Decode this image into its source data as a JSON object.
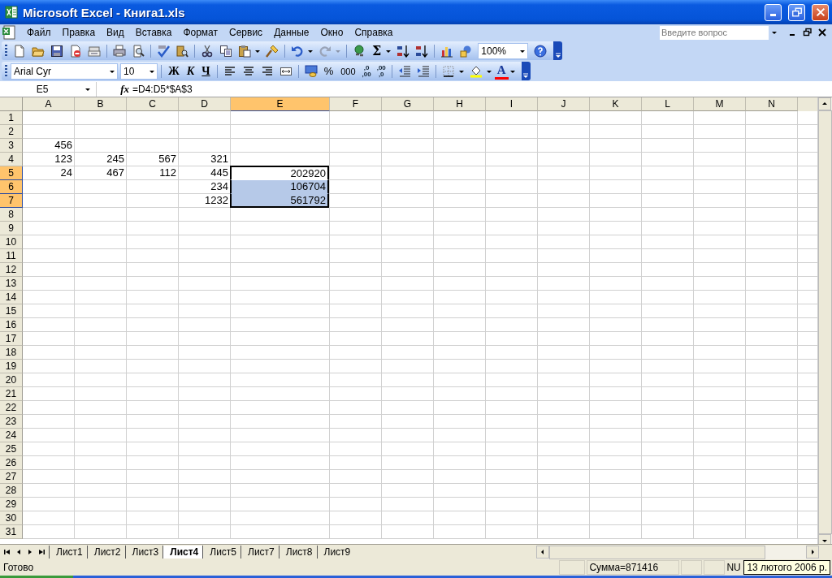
{
  "window": {
    "title": "Microsoft Excel - Книга1.xls"
  },
  "menu": [
    {
      "label": "Файл"
    },
    {
      "label": "Правка"
    },
    {
      "label": "Вид"
    },
    {
      "label": "Вставка"
    },
    {
      "label": "Формат"
    },
    {
      "label": "Сервис"
    },
    {
      "label": "Данные"
    },
    {
      "label": "Окно"
    },
    {
      "label": "Справка"
    }
  ],
  "help_search": {
    "placeholder": "Введите вопрос"
  },
  "standard_toolbar": {
    "autosum": "Σ",
    "zoom": "100%"
  },
  "formatting_toolbar": {
    "font": "Arial Cyr",
    "size": "10",
    "bold": "Ж",
    "italic": "К",
    "underline": "Ч",
    "percent": "%",
    "thousands": "000",
    "increase_decimal": [
      ",0",
      ",00"
    ],
    "decrease_decimal": [
      ",00",
      ",0"
    ],
    "font_color": "A"
  },
  "formula_bar": {
    "name_box": "E5",
    "fx": "fx",
    "formula": "=D4:D5*$A$3"
  },
  "columns": [
    {
      "label": "A",
      "selected": false
    },
    {
      "label": "B",
      "selected": false
    },
    {
      "label": "C",
      "selected": false
    },
    {
      "label": "D",
      "selected": false
    },
    {
      "label": "E",
      "selected": true
    },
    {
      "label": "F",
      "selected": false
    },
    {
      "label": "G",
      "selected": false
    },
    {
      "label": "H",
      "selected": false
    },
    {
      "label": "I",
      "selected": false
    },
    {
      "label": "J",
      "selected": false
    },
    {
      "label": "K",
      "selected": false
    },
    {
      "label": "L",
      "selected": false
    },
    {
      "label": "M",
      "selected": false
    },
    {
      "label": "N",
      "selected": false
    }
  ],
  "rows": [
    {
      "label": "1",
      "selected": false
    },
    {
      "label": "2",
      "selected": false
    },
    {
      "label": "3",
      "selected": false,
      "cells": [
        {
          "value": "456",
          "selected": false
        }
      ]
    },
    {
      "label": "4",
      "selected": false,
      "cells": [
        {
          "value": "123",
          "selected": false
        },
        {
          "value": "245",
          "selected": false
        },
        {
          "value": "567",
          "selected": false
        },
        {
          "value": "321",
          "selected": false
        }
      ]
    },
    {
      "label": "5",
      "selected": true,
      "cells": [
        {
          "value": "24",
          "selected": false
        },
        {
          "value": "467",
          "selected": false
        },
        {
          "value": "112",
          "selected": false
        },
        {
          "value": "445",
          "selected": false
        },
        {
          "value": "202920",
          "selected": true,
          "active": true
        }
      ]
    },
    {
      "label": "6",
      "selected": true,
      "cells": [
        null,
        null,
        null,
        {
          "value": "234",
          "selected": false
        },
        {
          "value": "106704",
          "selected": true,
          "active": false
        }
      ]
    },
    {
      "label": "7",
      "selected": true,
      "cells": [
        null,
        null,
        null,
        {
          "value": "1232",
          "selected": false
        },
        {
          "value": "561792",
          "selected": true,
          "active": false
        }
      ]
    },
    {
      "label": "8",
      "selected": false
    },
    {
      "label": "9",
      "selected": false
    },
    {
      "label": "10",
      "selected": false
    },
    {
      "label": "11",
      "selected": false
    },
    {
      "label": "12",
      "selected": false
    },
    {
      "label": "13",
      "selected": false
    },
    {
      "label": "14",
      "selected": false
    },
    {
      "label": "15",
      "selected": false
    },
    {
      "label": "16",
      "selected": false
    },
    {
      "label": "17",
      "selected": false
    },
    {
      "label": "18",
      "selected": false
    },
    {
      "label": "19",
      "selected": false
    },
    {
      "label": "20",
      "selected": false
    },
    {
      "label": "21",
      "selected": false
    },
    {
      "label": "22",
      "selected": false
    },
    {
      "label": "23",
      "selected": false
    },
    {
      "label": "24",
      "selected": false
    },
    {
      "label": "25",
      "selected": false
    },
    {
      "label": "26",
      "selected": false
    },
    {
      "label": "27",
      "selected": false
    },
    {
      "label": "28",
      "selected": false
    },
    {
      "label": "29",
      "selected": false
    },
    {
      "label": "30",
      "selected": false
    },
    {
      "label": "31",
      "selected": false
    }
  ],
  "sheet_tabs": [
    {
      "label": "Лист1",
      "selected": false
    },
    {
      "label": "Лист2",
      "selected": false
    },
    {
      "label": "Лист3",
      "selected": false
    },
    {
      "label": "Лист4",
      "selected": true
    },
    {
      "label": "Лист5",
      "selected": false
    },
    {
      "label": "Лист7",
      "selected": false
    },
    {
      "label": "Лист8",
      "selected": false
    },
    {
      "label": "Лист9",
      "selected": false
    }
  ],
  "status_bar": {
    "status": "Готово",
    "sum": "Сумма=871416",
    "num": "NU"
  },
  "tooltip": "13 лютого 2006 р."
}
